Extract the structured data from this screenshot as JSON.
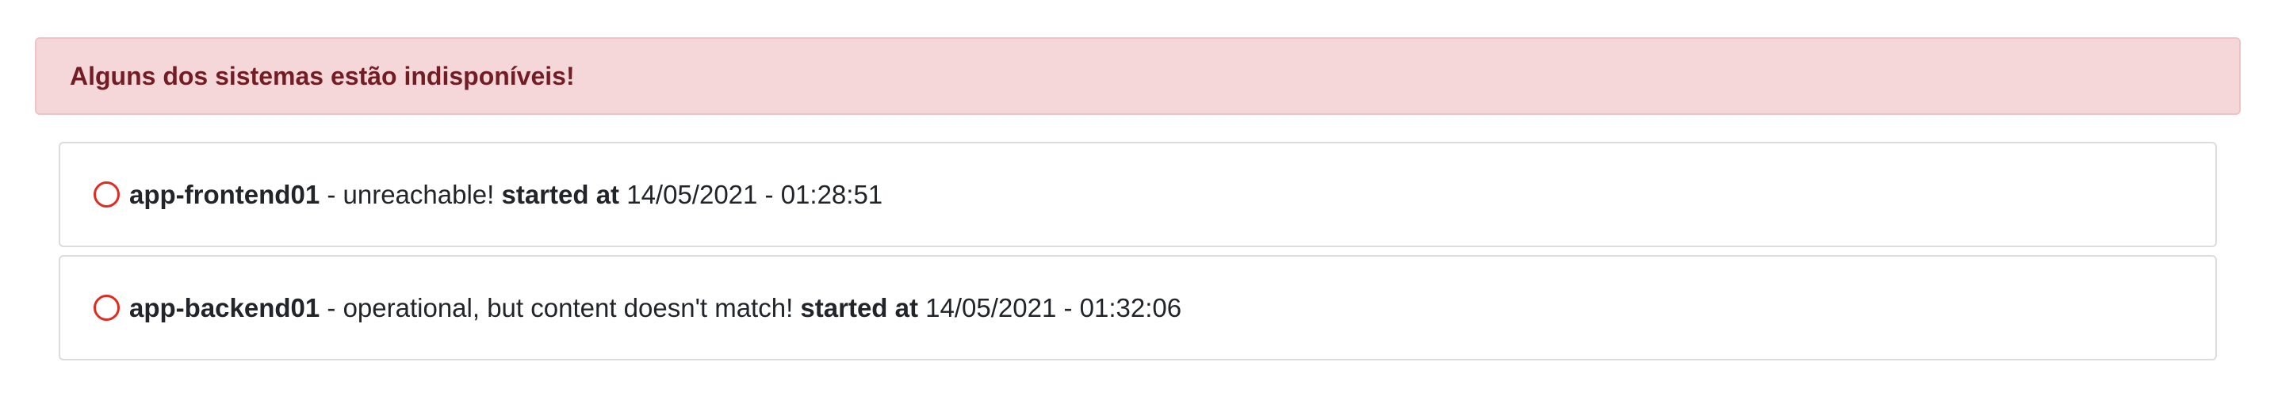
{
  "alert": {
    "message": "Alguns dos sistemas estão indisponíveis!"
  },
  "incidents": [
    {
      "icon": "empty-circle-icon",
      "name": "app-frontend01",
      "status": " - unreachable! ",
      "started_label": "started at",
      "started_value": " 14/05/2021 - 01:28:51"
    },
    {
      "icon": "empty-circle-icon",
      "name": "app-backend01",
      "status": " - operational, but content doesn't match! ",
      "started_label": "started at",
      "started_value": " 14/05/2021 - 01:32:06"
    }
  ],
  "colors": {
    "alert_background": "#f5d7da",
    "alert_text": "#721c24",
    "status_icon": "#e02b20"
  }
}
